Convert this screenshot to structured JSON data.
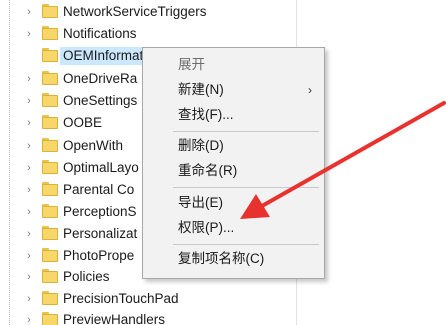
{
  "tree": {
    "items": [
      {
        "label": "NetworkServiceTriggers"
      },
      {
        "label": "Notifications"
      },
      {
        "label": "OEMInformati"
      },
      {
        "label": "OneDriveRa"
      },
      {
        "label": "OneSettings"
      },
      {
        "label": "OOBE"
      },
      {
        "label": "OpenWith"
      },
      {
        "label": "OptimalLayo"
      },
      {
        "label": "Parental Co"
      },
      {
        "label": "PerceptionS"
      },
      {
        "label": "Personalizat"
      },
      {
        "label": "PhotoPrope"
      },
      {
        "label": "Policies"
      },
      {
        "label": "PrecisionTouchPad"
      },
      {
        "label": "PreviewHandlers"
      }
    ],
    "selected_label": "OEMInformati"
  },
  "context_menu": {
    "items": {
      "expand": "展开",
      "new": "新建(N)",
      "find": "查找(F)...",
      "delete": "删除(D)",
      "rename": "重命名(R)",
      "export": "导出(E)",
      "permissions": "权限(P)...",
      "copy_key_name": "复制项名称(C)"
    },
    "submenu_arrow": "›"
  },
  "icons": {
    "folder": "folder-icon",
    "expander": "chevron-right-icon",
    "annotation": "red-arrow-annotation"
  },
  "colors": {
    "selection": "#cce8ff",
    "menu_background": "#f2f2f2",
    "folder": "#f7d76a",
    "annotation_arrow": "#e8322f"
  }
}
